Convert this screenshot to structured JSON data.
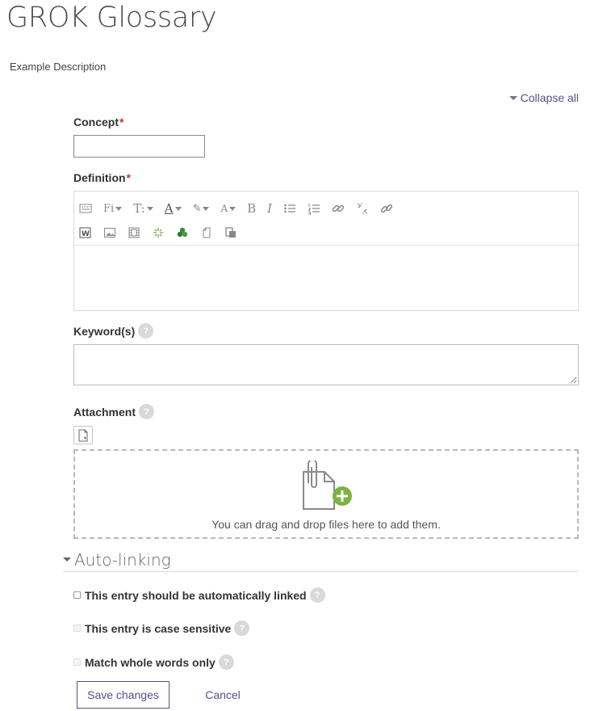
{
  "page": {
    "title": "GROK Glossary",
    "description": "Example Description",
    "collapse_all": "Collapse all"
  },
  "form": {
    "concept_label": "Concept",
    "concept_value": "",
    "definition_label": "Definition",
    "required_mark": "*",
    "keywords_label": "Keyword(s)",
    "keywords_value": "",
    "attachment_label": "Attachment",
    "drop_text": "You can drag and drop files here to add them.",
    "help_glyph": "?"
  },
  "toolbar": {
    "row1": [
      {
        "name": "toolbar-toggle-icon",
        "label": ""
      },
      {
        "name": "font-family-dropdown",
        "label": "Fi"
      },
      {
        "name": "font-size-dropdown",
        "label": "T:"
      },
      {
        "name": "font-color-dropdown",
        "label": "A"
      },
      {
        "name": "highlight-dropdown",
        "label": "✎"
      },
      {
        "name": "styles-dropdown",
        "label": "A"
      },
      {
        "name": "bold-button",
        "label": "B"
      },
      {
        "name": "italic-button",
        "label": "I"
      },
      {
        "name": "unordered-list-icon",
        "label": ""
      },
      {
        "name": "ordered-list-icon",
        "label": ""
      },
      {
        "name": "link-icon",
        "label": ""
      },
      {
        "name": "unlink-icon",
        "label": ""
      },
      {
        "name": "auto-link-icon",
        "label": ""
      }
    ],
    "row2": [
      "word-paste-icon",
      "image-icon",
      "media-icon",
      "equation-icon",
      "recycle-icon",
      "record-audio-icon",
      "paste-icon"
    ]
  },
  "autolinking": {
    "title": "Auto-linking",
    "options": [
      {
        "label": "This entry should be automatically linked",
        "checked": false,
        "enabled": true
      },
      {
        "label": "This entry is case sensitive",
        "checked": false,
        "enabled": false
      },
      {
        "label": "Match whole words only",
        "checked": false,
        "enabled": false
      }
    ]
  },
  "buttons": {
    "save": "Save changes",
    "cancel": "Cancel"
  },
  "colors": {
    "accent": "#5a4e8c",
    "required": "#c0392b",
    "dropzone_plus": "#7cb342"
  }
}
